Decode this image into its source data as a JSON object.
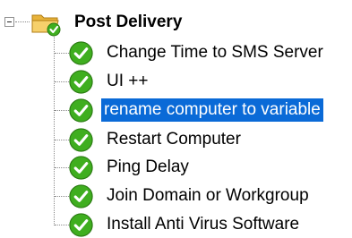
{
  "tree": {
    "group": {
      "label": "Post Delivery",
      "icon": "folder-with-check-icon",
      "expanded": true
    },
    "items": [
      {
        "label": "Change Time to SMS Server",
        "icon": "green-check-icon",
        "selected": false
      },
      {
        "label": "UI ++",
        "icon": "green-check-icon",
        "selected": false
      },
      {
        "label": "rename computer to variable",
        "icon": "green-check-icon",
        "selected": true
      },
      {
        "label": "Restart Computer",
        "icon": "green-check-icon",
        "selected": false
      },
      {
        "label": "Ping Delay",
        "icon": "green-check-icon",
        "selected": false
      },
      {
        "label": "Join Domain or Workgroup",
        "icon": "green-check-icon",
        "selected": false
      },
      {
        "label": "Install Anti Virus Software",
        "icon": "green-check-icon",
        "selected": false
      }
    ]
  },
  "colors": {
    "selection": "#0a6ad7",
    "check": "#3fae1f"
  }
}
